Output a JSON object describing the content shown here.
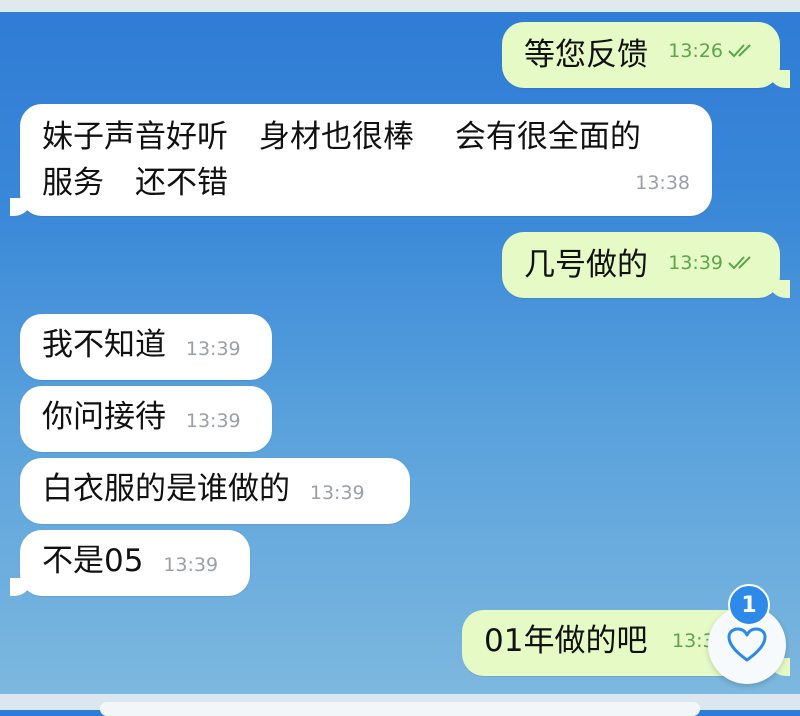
{
  "messages": [
    {
      "id": "m1",
      "side": "out",
      "text": "等您反馈",
      "time": "13:26",
      "read": true
    },
    {
      "id": "m2",
      "side": "in",
      "text_line1": "妹子声音好听　身材也很棒　 会有很全面的",
      "text_line2": "服务　还不错",
      "time": "13:38"
    },
    {
      "id": "m3",
      "side": "out",
      "text": "几号做的",
      "time": "13:39",
      "read": true
    },
    {
      "id": "m4",
      "side": "in",
      "text": "我不知道",
      "time": "13:39"
    },
    {
      "id": "m5",
      "side": "in",
      "text": "你问接待",
      "time": "13:39"
    },
    {
      "id": "m6",
      "side": "in",
      "text": "白衣服的是谁做的",
      "time": "13:39"
    },
    {
      "id": "m7",
      "side": "in",
      "text": "不是05",
      "time": "13:39"
    },
    {
      "id": "m8",
      "side": "out",
      "text": "01年做的吧",
      "time": "13:3"
    }
  ],
  "reaction_button": {
    "icon": "heart-icon",
    "badge_count": "1"
  },
  "colors": {
    "incoming": "#ffffff",
    "outgoing": "#e6fac6",
    "accent": "#2d8ae8",
    "read_check": "#5aa64a"
  }
}
